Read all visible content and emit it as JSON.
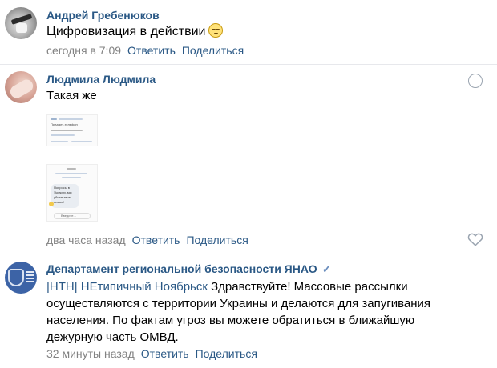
{
  "comments": [
    {
      "author": "Андрей Гребенюков",
      "text": "Цифровизация в действии",
      "time": "сегодня в 7:09",
      "reply_label": "Ответить",
      "share_label": "Поделиться"
    },
    {
      "author": "Людмила Людмила",
      "text": "Такая же",
      "time": "два часа назад",
      "reply_label": "Ответить",
      "share_label": "Поделиться",
      "attachments": {
        "shot1_title": "Предмет-телефон",
        "shot2_lines": [
          "Попросы в",
          "Украину, мы",
          "убьем твою",
          "семью!"
        ],
        "shot2_input": "Введите..."
      }
    },
    {
      "author": "Департамент региональной безопасности ЯНАО",
      "text_prefix": "|НТН| НЕтипичный Ноябрьск",
      "text_body": " Здравствуйте! Массовые рассылки осуществляются с территории Украины и делаются для запугивания населения. По фактам угроз вы можете обратиться в ближайшую дежурную часть ОМВД.",
      "time": "32 минуты назад",
      "reply_label": "Ответить",
      "share_label": "Поделиться"
    }
  ],
  "icons": {
    "report": "exclamation-circle-icon",
    "like": "heart-icon",
    "verified": "checkmark-icon",
    "emoji": "smiling-face-icon"
  },
  "colors": {
    "link": "#2a5885",
    "meta": "#828282",
    "divider": "#e7e8ec"
  }
}
